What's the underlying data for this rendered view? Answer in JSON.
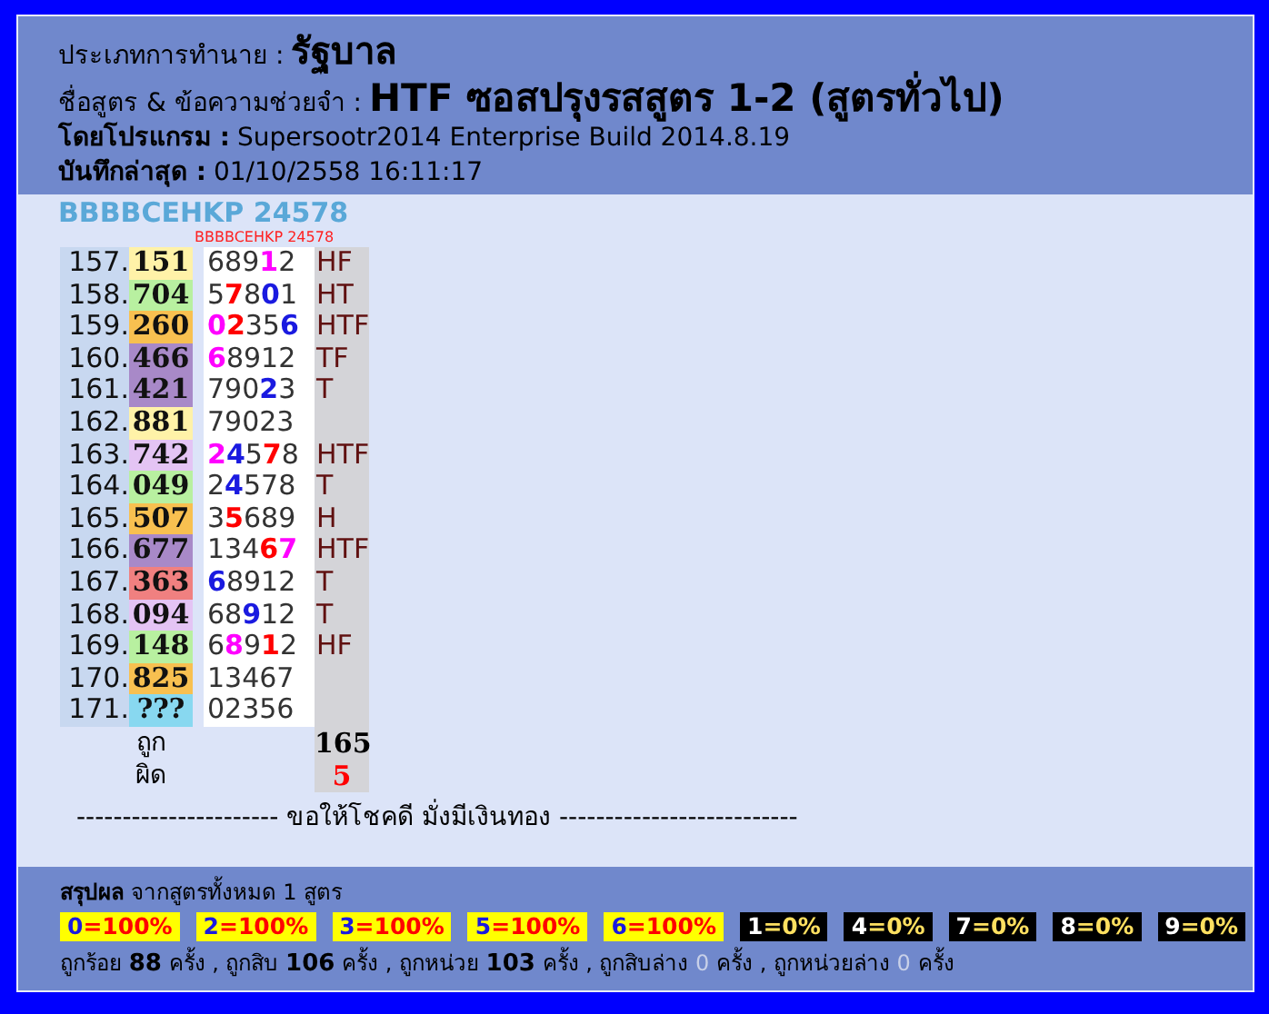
{
  "header": {
    "type_label": "ประเภทการทำนาย :",
    "type_value": "รัฐบาล",
    "formula_label": "ชื่อสูตร & ข้อความช่วยจำ :",
    "formula_value": "HTF ซอสปรุงรสสูตร 1-2 (สูตรทั่วไป)",
    "program_label": "โดยโปรแกรม :",
    "program_value": "Supersootr2014 Enterprise Build 2014.8.19",
    "saved_label": "บันทึกล่าสุด :",
    "saved_value": "01/10/2558 16:11:17"
  },
  "code_title": "BBBBCEHKP 24578",
  "column_caption": "BBBBCEHKP 24578",
  "rows": [
    {
      "index": "157.",
      "result": "151",
      "color": "#fff2a8",
      "digits": [
        {
          "text": "689",
          "color": "#333333"
        },
        {
          "text": "1",
          "color": "#ff00ff"
        },
        {
          "text": "2",
          "color": "#333333"
        }
      ],
      "hit": "HF"
    },
    {
      "index": "158.",
      "result": "704",
      "color": "#b8f0a0",
      "digits": [
        {
          "text": "5",
          "color": "#333333"
        },
        {
          "text": "7",
          "color": "#ff0000"
        },
        {
          "text": "8",
          "color": "#333333"
        },
        {
          "text": "0",
          "color": "#1a1ae0"
        },
        {
          "text": "1",
          "color": "#333333"
        }
      ],
      "hit": "HT"
    },
    {
      "index": "159.",
      "result": "260",
      "color": "#f8c050",
      "digits": [
        {
          "text": "0",
          "color": "#ff00ff"
        },
        {
          "text": "2",
          "color": "#ff0000"
        },
        {
          "text": "35",
          "color": "#333333"
        },
        {
          "text": "6",
          "color": "#1a1ae0"
        }
      ],
      "hit": "HTF"
    },
    {
      "index": "160.",
      "result": "466",
      "color": "#a889c8",
      "digits": [
        {
          "text": "6",
          "color": "#ff00ff"
        },
        {
          "text": "8912",
          "color": "#333333"
        }
      ],
      "hit": "TF"
    },
    {
      "index": "161.",
      "result": "421",
      "color": "#a889c8",
      "digits": [
        {
          "text": "790",
          "color": "#333333"
        },
        {
          "text": "2",
          "color": "#1a1ae0"
        },
        {
          "text": "3",
          "color": "#333333"
        }
      ],
      "hit": "T"
    },
    {
      "index": "162.",
      "result": "881",
      "color": "#fff2a8",
      "digits": [
        {
          "text": "79023",
          "color": "#333333"
        }
      ]
    },
    {
      "index": "163.",
      "result": "742",
      "color": "#e4c4f4",
      "digits": [
        {
          "text": "2",
          "color": "#ff00ff"
        },
        {
          "text": "4",
          "color": "#1a1ae0"
        },
        {
          "text": "5",
          "color": "#333333"
        },
        {
          "text": "7",
          "color": "#ff0000"
        },
        {
          "text": "8",
          "color": "#333333"
        }
      ],
      "hit": "HTF"
    },
    {
      "index": "164.",
      "result": "049",
      "color": "#b8f0a0",
      "digits": [
        {
          "text": "2",
          "color": "#333333"
        },
        {
          "text": "4",
          "color": "#1a1ae0"
        },
        {
          "text": "578",
          "color": "#333333"
        }
      ],
      "hit": "T"
    },
    {
      "index": "165.",
      "result": "507",
      "color": "#f8c050",
      "digits": [
        {
          "text": "3",
          "color": "#333333"
        },
        {
          "text": "5",
          "color": "#ff0000"
        },
        {
          "text": "689",
          "color": "#333333"
        }
      ],
      "hit": "H"
    },
    {
      "index": "166.",
      "result": "677",
      "color": "#a889c8",
      "digits": [
        {
          "text": "134",
          "color": "#333333"
        },
        {
          "text": "6",
          "color": "#ff0000"
        },
        {
          "text": "7",
          "color": "#ff00ff"
        }
      ],
      "hit": "HTF"
    },
    {
      "index": "167.",
      "result": "363",
      "color": "#f08080",
      "digits": [
        {
          "text": "6",
          "color": "#1a1ae0"
        },
        {
          "text": "8912",
          "color": "#333333"
        }
      ],
      "hit": "T"
    },
    {
      "index": "168.",
      "result": "094",
      "color": "#e4c4f4",
      "digits": [
        {
          "text": "68",
          "color": "#333333"
        },
        {
          "text": "9",
          "color": "#1a1ae0"
        },
        {
          "text": "12",
          "color": "#333333"
        }
      ],
      "hit": "T"
    },
    {
      "index": "169.",
      "result": "148",
      "color": "#b8f0a0",
      "digits": [
        {
          "text": "6",
          "color": "#333333"
        },
        {
          "text": "8",
          "color": "#ff00ff"
        },
        {
          "text": "9",
          "color": "#333333"
        },
        {
          "text": "1",
          "color": "#ff0000"
        },
        {
          "text": "2",
          "color": "#333333"
        }
      ],
      "hit": "HF"
    },
    {
      "index": "170.",
      "result": "825",
      "color": "#f8c050",
      "digits": [
        {
          "text": "13467",
          "color": "#333333"
        }
      ]
    },
    {
      "index": "171.",
      "result": "???",
      "color": "#88d8f0",
      "digits": [
        {
          "text": "02356",
          "color": "#333333"
        }
      ]
    }
  ],
  "totals": [
    {
      "label": "ถูก",
      "value": "165",
      "kind": "correct"
    },
    {
      "label": "ผิด",
      "value": "5",
      "kind": "wrong"
    }
  ],
  "divider_text": "---------------------- ขอให้โชคดี มั่งมีเงินทอง --------------------------",
  "summary": {
    "title": "สรุปผล",
    "subtitle": "จากสูตรทั้งหมด 1 สูตร",
    "badges": [
      {
        "digit": "0",
        "rest": "=100%",
        "kind": "hit"
      },
      {
        "digit": "2",
        "rest": "=100%",
        "kind": "hit"
      },
      {
        "digit": "3",
        "rest": "=100%",
        "kind": "hit"
      },
      {
        "digit": "5",
        "rest": "=100%",
        "kind": "hit"
      },
      {
        "digit": "6",
        "rest": "=100%",
        "kind": "hit"
      },
      {
        "digit": "1",
        "rest": "=0%",
        "kind": "miss"
      },
      {
        "digit": "4",
        "rest": "=0%",
        "kind": "miss"
      },
      {
        "digit": "7",
        "rest": "=0%",
        "kind": "miss"
      },
      {
        "digit": "8",
        "rest": "=0%",
        "kind": "miss"
      },
      {
        "digit": "9",
        "rest": "=0%",
        "kind": "miss"
      }
    ],
    "counts": [
      {
        "label": "ถูกร้อย",
        "count": "88",
        "unit": "ครั้ง",
        "kind": "some"
      },
      {
        "label": "ถูกสิบ",
        "count": "106",
        "unit": "ครั้ง",
        "kind": "some"
      },
      {
        "label": "ถูกหน่วย",
        "count": "103",
        "unit": "ครั้ง",
        "kind": "some"
      },
      {
        "label": "ถูกสิบล่าง",
        "count": "0",
        "unit": "ครั้ง",
        "kind": "none"
      },
      {
        "label": "ถูกหน่วยล่าง",
        "count": "0",
        "unit": "ครั้ง",
        "kind": "none"
      }
    ],
    "separator": ","
  }
}
